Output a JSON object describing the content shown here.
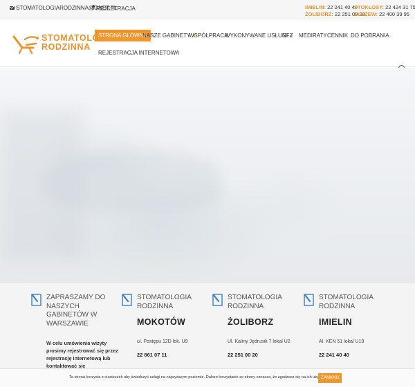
{
  "topbar": {
    "email": "STOMATOLOGIARODZINNA@ONET.PL",
    "facebook_label": "REJESTRACJA",
    "phones": [
      {
        "label": "IMIELIN:",
        "number": "22 241 40 40"
      },
      {
        "label": "ŻOLIBORZ:",
        "number": "22 251 00 20"
      },
      {
        "label": "STOKŁOSY:",
        "number": "22 424 31 75"
      },
      {
        "label": "SŁUŻEW:",
        "number": "22 400 39 95"
      }
    ]
  },
  "header": {
    "logo_line1": "STOMATOLOGIA",
    "logo_line2": "RODZINNA",
    "nav": [
      {
        "label": "STRONA GŁÓWNA"
      },
      {
        "label": "NASZE GABINETY"
      },
      {
        "label": "WSPÓŁPRACA"
      },
      {
        "label": "WYKONYWANE USŁUGI"
      },
      {
        "label": "NFZ"
      },
      {
        "label": "MEDIRATY"
      },
      {
        "label": "CENNIK"
      },
      {
        "label": "DO POBRANIA"
      },
      {
        "label": "REJESTRACJA INTERNETOWA"
      }
    ],
    "accent_color": "#f0962d"
  },
  "info": {
    "intro_title": "ZAPRASZAMY DO NASZYCH GABINETÓW W WARSZAWIE",
    "intro_note": "W celu umówienia wizyty prosimy rejestrować się przez rejestrację internetową lub kontaktować się",
    "clinics": [
      {
        "title": "STOMATOLOGIA RODZINNA",
        "city": "MOKOTÓW",
        "address": "ul. Postępu 12D lok. U9",
        "phone": "22 861 07 11"
      },
      {
        "title": "STOMATOLOGIA RODZINNA",
        "city": "ŻOLIBORZ",
        "address": "Ul. Kaliny Jędrusik 7 lokal U2",
        "phone": "22 251 00 20"
      },
      {
        "title": "STOMATOLOGIA RODZINNA",
        "city": "IMIELIN",
        "address": "Al. KEN 51 lokal U19",
        "phone": "22 241 40 40"
      }
    ]
  },
  "cookie": {
    "text": "Ta strona korzysta z ciasteczek aby świadczyć usługi na najwyższym poziomie. Dalsze korzystanie ze strony oznacza, że zgadzasz się na ich użycie.",
    "button": "ZAMKNIJ"
  }
}
